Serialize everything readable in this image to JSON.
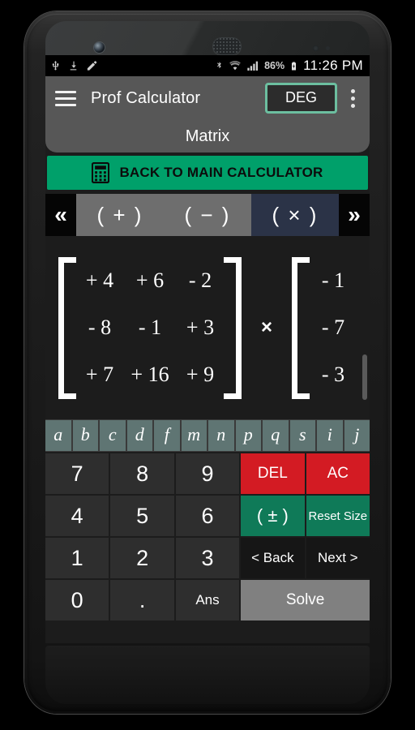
{
  "status_bar": {
    "left_icons": [
      "usb-icon",
      "download-icon",
      "edit-pencil-icon"
    ],
    "right_icons": [
      "bluetooth-icon",
      "wifi-icon",
      "cellular-signal-icon",
      "battery-charging-icon"
    ],
    "battery_percent": "86%",
    "clock": "11:26 PM"
  },
  "toolbar": {
    "menu_icon": "hamburger-menu-icon",
    "title": "Prof Calculator",
    "angle_mode": "DEG",
    "overflow_icon": "overflow-menu-icon",
    "accent_color": "#6cbfa0"
  },
  "subtitle": "Matrix",
  "back_button": {
    "label": "BACK TO MAIN CALCULATOR",
    "icon": "calculator-icon",
    "color": "#00a06a"
  },
  "operations": {
    "prev_icon": "«",
    "next_icon": "»",
    "items": [
      {
        "label": "( + )",
        "selected": false
      },
      {
        "label": "( − )",
        "selected": false
      },
      {
        "label": "( × )",
        "selected": true
      }
    ],
    "selected_color": "#2b3347"
  },
  "matrix_editor": {
    "operator": "×",
    "matrix_a": {
      "rows": 3,
      "cols": 3,
      "cells": [
        [
          "+ 4",
          "+ 6",
          "- 2"
        ],
        [
          "- 8",
          "- 1",
          "+ 3"
        ],
        [
          "+ 7",
          "+ 16",
          "+ 9"
        ]
      ]
    },
    "matrix_b": {
      "rows": 3,
      "cols": 2,
      "visible_note": "clipped at right edge",
      "cells": [
        [
          "- 1",
          "+"
        ],
        [
          "- 7",
          "+"
        ],
        [
          "- 3",
          "+"
        ]
      ]
    }
  },
  "variable_keys": [
    "a",
    "b",
    "c",
    "d",
    "f",
    "m",
    "n",
    "p",
    "q",
    "s",
    "i",
    "j"
  ],
  "keypad": {
    "rows": [
      [
        {
          "label": "7",
          "style": "num"
        },
        {
          "label": "8",
          "style": "num"
        },
        {
          "label": "9",
          "style": "num"
        },
        {
          "label": "DEL",
          "style": "red"
        },
        {
          "label": "AC",
          "style": "red"
        }
      ],
      [
        {
          "label": "4",
          "style": "num"
        },
        {
          "label": "5",
          "style": "num"
        },
        {
          "label": "6",
          "style": "num"
        },
        {
          "label": "( ± )",
          "style": "green"
        },
        {
          "label": "Reset Size",
          "style": "green sm"
        }
      ],
      [
        {
          "label": "1",
          "style": "num"
        },
        {
          "label": "2",
          "style": "num"
        },
        {
          "label": "3",
          "style": "num"
        },
        {
          "label": "< Back",
          "style": "dark"
        },
        {
          "label": "Next >",
          "style": "dark"
        }
      ],
      [
        {
          "label": "0",
          "style": "num"
        },
        {
          "label": ".",
          "style": "num"
        },
        {
          "label": "Ans",
          "style": "ans"
        },
        {
          "label": "Solve",
          "style": "solve"
        }
      ]
    ],
    "colors": {
      "delete": "#d31b23",
      "sign": "#0f7a58",
      "solve": "#808080"
    }
  }
}
